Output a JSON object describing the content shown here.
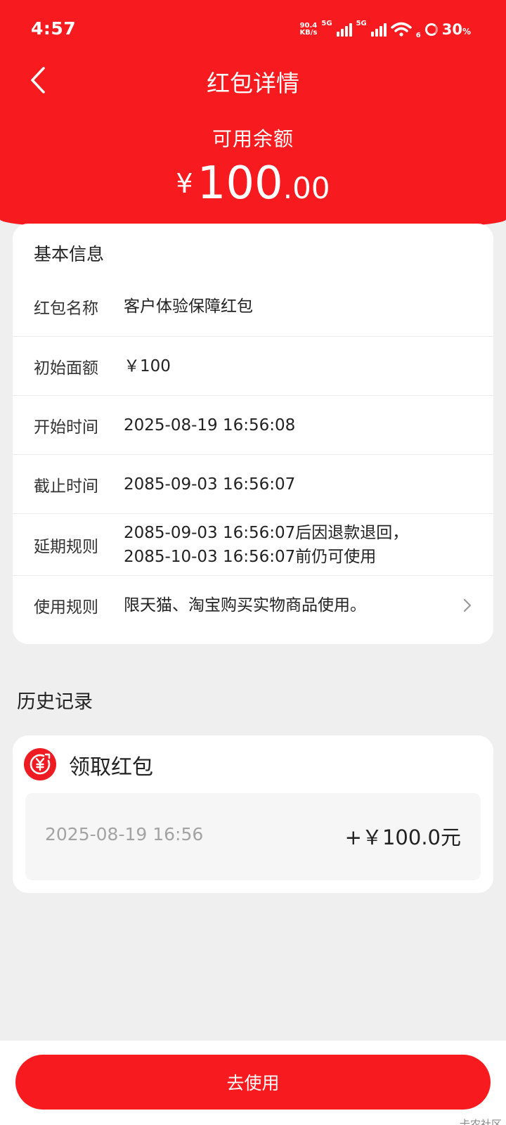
{
  "status_bar": {
    "time": "4:57",
    "net_speed_value": "90.4",
    "net_speed_unit": "KB/s",
    "network_1": "5G",
    "network_2": "5G",
    "wifi_sub": "6",
    "battery": "30",
    "battery_unit": "%"
  },
  "header": {
    "title": "红包详情",
    "balance_label": "可用余额",
    "currency": "¥",
    "balance_integer": "100",
    "balance_decimal": ".00"
  },
  "basic_info": {
    "title": "基本信息",
    "rows": [
      {
        "label": "红包名称",
        "value": "客户体验保障红包"
      },
      {
        "label": "初始面额",
        "value": "￥100"
      },
      {
        "label": "开始时间",
        "value": "2025-08-19 16:56:08"
      },
      {
        "label": "截止时间",
        "value": "2085-09-03 16:56:07"
      },
      {
        "label": "延期规则",
        "value_line1": "2085-09-03 16:56:07后因退款退回，",
        "value_line2": "2085-10-03 16:56:07前仍可使用"
      },
      {
        "label": "使用规则",
        "value": "限天猫、淘宝购买实物商品使用。"
      }
    ]
  },
  "history": {
    "heading": "历史记录",
    "item_title": "领取红包",
    "date": "2025-08-19 16:56",
    "amount": "+￥100.0元"
  },
  "action": {
    "button_label": "去使用"
  },
  "watermark": "卡农社区",
  "colors": {
    "brand_red": "#f71a1e",
    "background": "#efefef",
    "muted_text": "#a3a3a3"
  },
  "icons": {
    "back": "chevron-left-icon",
    "rule_detail": "chevron-right-icon",
    "history_item": "red-packet-yuan-icon"
  }
}
